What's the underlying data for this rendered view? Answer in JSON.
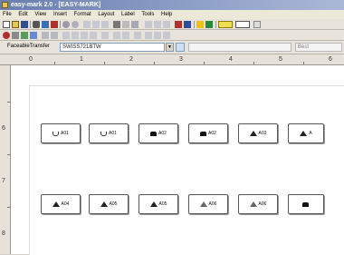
{
  "window": {
    "title": "easy-mark 2.0 - [EASY-MARK]"
  },
  "menubar": {
    "items": [
      "File",
      "Edit",
      "View",
      "Insert",
      "Format",
      "Layout",
      "Label",
      "Tools",
      "Help"
    ]
  },
  "toolbar3": {
    "font_label": "FaceableTransfer",
    "font_value": "SWISS721BTW",
    "combo3_value": "Best"
  },
  "ruler": {
    "h_labels": [
      "0",
      "1",
      "2",
      "3",
      "4",
      "5",
      "6"
    ],
    "v_labels": [
      "6",
      "7",
      "8"
    ]
  },
  "labels": {
    "row1": [
      {
        "text": "A01",
        "icon": "cup-icon"
      },
      {
        "text": "A01",
        "icon": "cup-icon"
      },
      {
        "text": "A02",
        "icon": "phone-icon"
      },
      {
        "text": "A02",
        "icon": "phone-icon"
      },
      {
        "text": "A03",
        "icon": "warning-triangle-icon"
      },
      {
        "text": "A",
        "icon": "warning-triangle-icon"
      }
    ],
    "row2": [
      {
        "text": "A04",
        "icon": "warning-triangle-icon"
      },
      {
        "text": "A05",
        "icon": "warning-triangle-icon"
      },
      {
        "text": "A05",
        "icon": "warning-triangle-icon"
      },
      {
        "text": "A06",
        "icon": "warning-triangle-outline-icon"
      },
      {
        "text": "A06",
        "icon": "warning-triangle-outline-icon"
      },
      {
        "text": "",
        "icon": "phone-icon"
      }
    ]
  }
}
